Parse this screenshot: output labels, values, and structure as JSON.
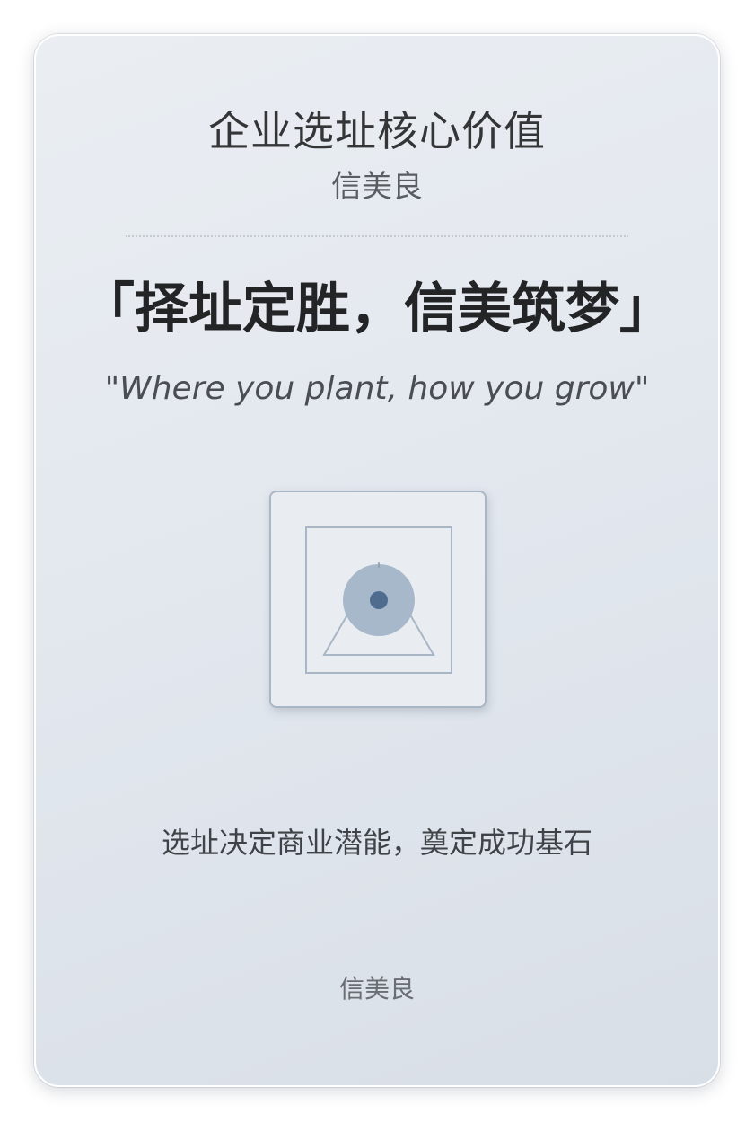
{
  "card": {
    "title": "企业选址核心价值",
    "author_top": "信美良",
    "slogan": "「择址定胜，信美筑梦」",
    "tagline": "\"Where you plant, how you grow\"",
    "icon": "location-pin-in-frame-icon",
    "description": "选址决定商业潜能，奠定成功基石",
    "author_bottom": "信美良"
  },
  "colors": {
    "background_start": "#eaeef3",
    "background_end": "#d9dfe7",
    "icon_circle": "#a7b8cb",
    "icon_dot": "#4f6c8e",
    "icon_lines": "#a9b6c6"
  }
}
